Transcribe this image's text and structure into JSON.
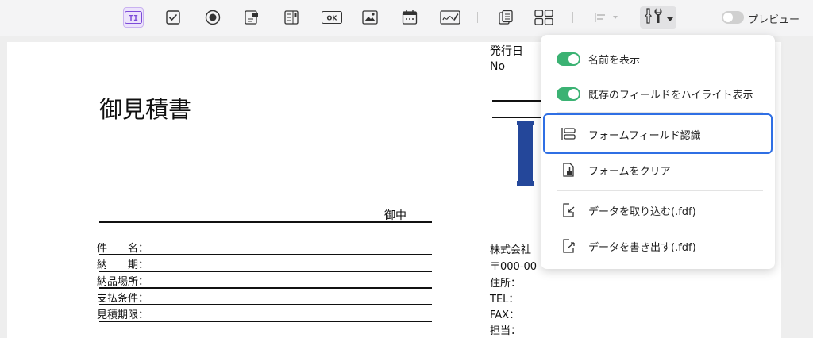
{
  "toolbar": {
    "icons": [
      "text-field-icon",
      "checkbox-icon",
      "radio-button-icon",
      "combo-box-icon",
      "list-box-icon",
      "button-icon",
      "image-field-icon",
      "date-field-icon",
      "signature-field-icon",
      "form-list-icon",
      "grid-layout-icon",
      "align-icon",
      "tools-icon"
    ],
    "text_field_icon_text": "TI",
    "ok_button_icon_text": "OK",
    "preview_label": "プレビュー"
  },
  "document": {
    "title": "御見積書",
    "onchu": "御中",
    "fields": [
      "件　　名：",
      "納　　期：",
      "納品場所：",
      "支払条件：",
      "見積期限："
    ],
    "hakko": "発行日",
    "no": "No",
    "company_lines": [
      "株式会社",
      "〒000-00",
      "住所：",
      "TEL：",
      "FAX：",
      "担当："
    ]
  },
  "menu": {
    "items": [
      {
        "label": "名前を表示",
        "toggle_on": true
      },
      {
        "label": "既存のフィールドをハイライト表示",
        "toggle_on": true
      },
      {
        "label": "フォームフィールド認識",
        "icon": "form-recognition-icon"
      },
      {
        "label": "フォームをクリア",
        "icon": "clear-form-icon"
      },
      {
        "label": "データを取り込む(.fdf)",
        "icon": "import-data-icon"
      },
      {
        "label": "データを書き出す(.fdf)",
        "icon": "export-data-icon"
      }
    ]
  },
  "colors": {
    "accent": "#2f6fe4",
    "toggle_on": "#3bb273",
    "logo_blue": "#24479a",
    "active_tool": "#ece3fb"
  }
}
